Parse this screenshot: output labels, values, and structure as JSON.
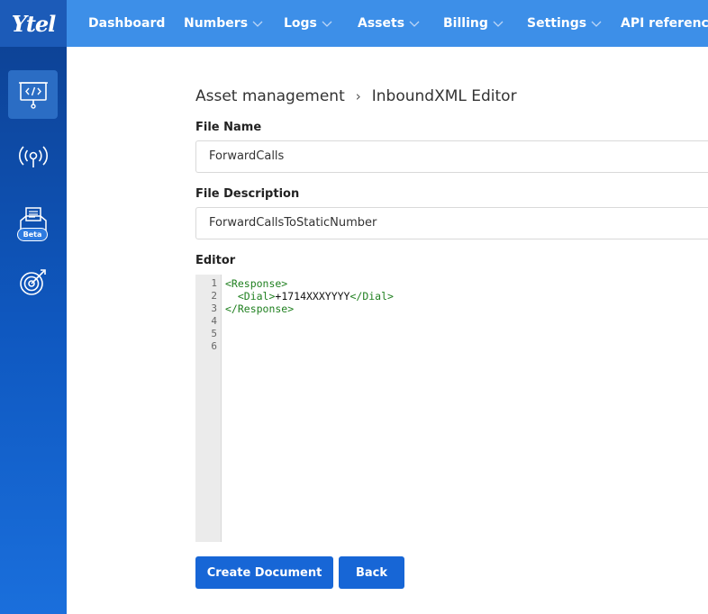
{
  "brand": {
    "logo_text": "Ytel"
  },
  "nav": {
    "items": [
      {
        "label": "Dashboard",
        "dropdown": false
      },
      {
        "label": "Numbers",
        "dropdown": true
      },
      {
        "label": "Logs",
        "dropdown": true
      },
      {
        "label": "Assets",
        "dropdown": true
      },
      {
        "label": "Billing",
        "dropdown": true
      },
      {
        "label": "Settings",
        "dropdown": true
      },
      {
        "label": "API reference",
        "dropdown": false
      }
    ]
  },
  "sidebar": {
    "items": [
      {
        "icon": "code-presentation-icon",
        "active": true
      },
      {
        "icon": "broadcast-antenna-icon",
        "active": false
      },
      {
        "icon": "inbox-document-icon",
        "active": false,
        "badge": "Beta"
      },
      {
        "icon": "target-arrow-icon",
        "active": false
      }
    ]
  },
  "breadcrumb": {
    "parent": "Asset management",
    "separator": "›",
    "current": "InboundXML Editor"
  },
  "form": {
    "file_name_label": "File Name",
    "file_name_value": "ForwardCalls",
    "file_description_label": "File Description",
    "file_description_value": "ForwardCallsToStaticNumber",
    "editor_label": "Editor"
  },
  "editor": {
    "line_numbers": [
      "1",
      "2",
      "3",
      "4",
      "5",
      "6"
    ],
    "lines": [
      {
        "open": "<Response>",
        "text": "",
        "close": ""
      },
      {
        "open": "  <Dial>",
        "text": "+1714XXXYYYY",
        "close": "</Dial>"
      },
      {
        "open": "</Response>",
        "text": "",
        "close": ""
      },
      {
        "open": "",
        "text": "",
        "close": ""
      },
      {
        "open": "",
        "text": "",
        "close": ""
      },
      {
        "open": "",
        "text": "",
        "close": ""
      }
    ]
  },
  "actions": {
    "create_label": "Create Document",
    "back_label": "Back"
  },
  "colors": {
    "nav_bg": "#3d8fe8",
    "sidebar_top": "#0d4397",
    "button": "#1766d6",
    "xml_tag": "#208020"
  }
}
